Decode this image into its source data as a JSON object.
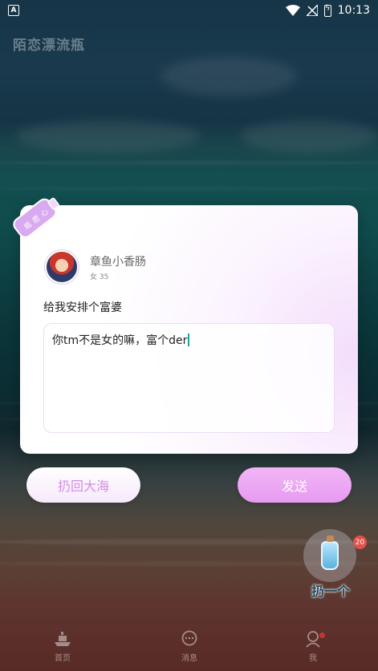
{
  "status_bar": {
    "time": "10:13",
    "left_icon_letter": "A"
  },
  "app": {
    "title": "陌恋漂流瓶"
  },
  "card": {
    "tag_chars": [
      "心",
      "愿",
      "瓶"
    ],
    "user": {
      "name": "章鱼小香肠",
      "meta": "女 35"
    },
    "message": "给我安排个富婆",
    "reply": {
      "value": "你tm不是女的嘛，富个der"
    }
  },
  "actions": {
    "throw_back": "扔回大海",
    "send": "发送"
  },
  "float_button": {
    "label": "扔一个",
    "badge": "20"
  },
  "tabs": [
    {
      "label": "首页",
      "icon": "ship-icon"
    },
    {
      "label": "消息",
      "icon": "chat-icon"
    },
    {
      "label": "我",
      "icon": "profile-icon"
    }
  ],
  "colors": {
    "send_button": "#e79af1",
    "throw_button_text": "#d58ae8",
    "badge": "#e2504b"
  }
}
